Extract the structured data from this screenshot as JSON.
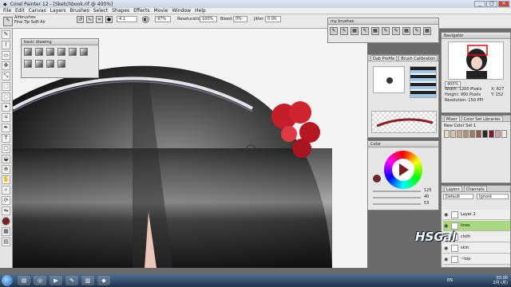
{
  "window": {
    "title": "Corel Painter 12 - [Sketchbook.rif @ 400%]",
    "controls": [
      "_",
      "□",
      "✕"
    ]
  },
  "menu": [
    "File",
    "Edit",
    "Canvas",
    "Layers",
    "Brushes",
    "Select",
    "Shapes",
    "Effects",
    "Movie",
    "Window",
    "Help"
  ],
  "propbar": {
    "brush_category": "Airbrushes",
    "brush_variant": "Fine Tip Soft Air",
    "size_value": "4.1",
    "opacity_value": "97%",
    "resaturation_label": "Resaturation:",
    "resaturation_value": "100%",
    "bleed_label": "Bleed:",
    "bleed_value": "0%",
    "jitter_label": "Jitter:",
    "jitter_value": "0.00"
  },
  "basic_drawing": {
    "title": "basic drawing"
  },
  "my_brushes": {
    "title": "my brushes"
  },
  "dab_panel": {
    "tabs": [
      "Dab Profile",
      "Brush Calibration"
    ]
  },
  "color_panel": {
    "title": "Color",
    "values": [
      "125",
      "40",
      "53"
    ]
  },
  "navigator": {
    "title": "Navigator",
    "zoom": "400%",
    "width_label": "Width:",
    "width": "1200 Pixels",
    "height_label": "Height:",
    "height": "900 Pixels",
    "resolution_label": "Resolution:",
    "resolution": "150 PPI",
    "x_label": "X:",
    "x": "627",
    "y_label": "Y:",
    "y": "152"
  },
  "mixer": {
    "tabs": [
      "Mixer",
      "Color Set Libraries"
    ],
    "set_name": "New Color Set 1",
    "swatches": [
      "#e9d7c8",
      "#d8bfa9",
      "#caa58d",
      "#b98f76",
      "#a27864",
      "#8a5c4c",
      "#2b2b2b",
      "#7a1f27",
      "#cfa3a0",
      "#f1e6dc"
    ]
  },
  "layers": {
    "tabs": [
      "Layers",
      "Channels"
    ],
    "composite_method": "Default",
    "preserve": "Ignore",
    "items": [
      {
        "name": "Layer 2"
      },
      {
        "name": "lines"
      },
      {
        "name": "cloth"
      },
      {
        "name": "skin"
      },
      {
        "name": "~top"
      }
    ]
  },
  "taskbar": {
    "time": "03:00",
    "date": "2月 (月)",
    "lang": "EN"
  },
  "watermark": "HSGal"
}
